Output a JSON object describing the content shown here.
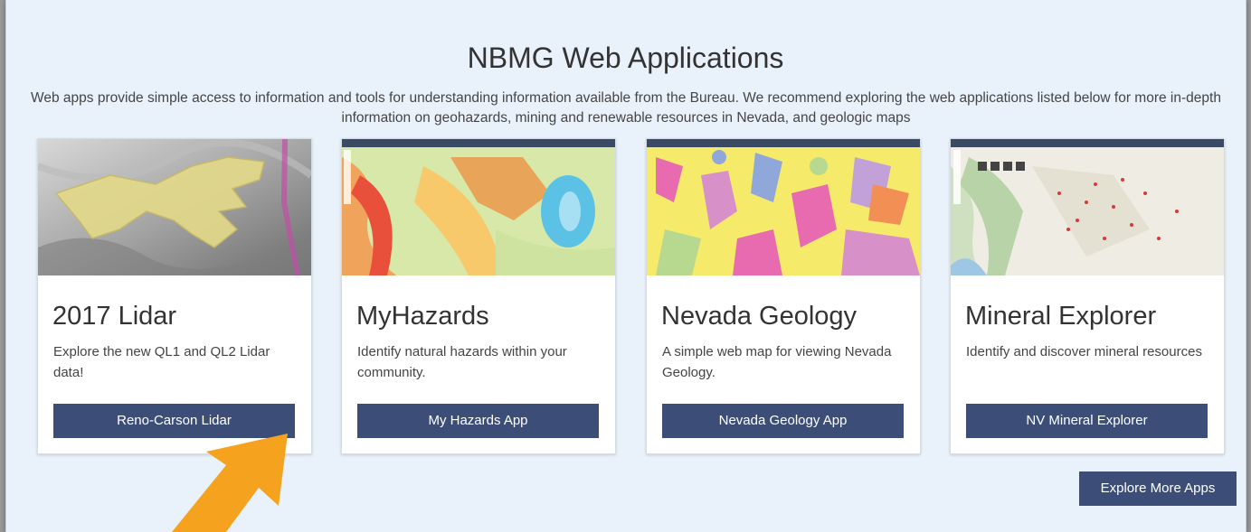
{
  "header": {
    "title": "NBMG Web Applications",
    "subtitle": "Web apps provide simple access to information and tools for understanding information available from the Bureau. We recommend exploring the web applications listed below for more in-depth information on geohazards, mining and renewable resources in Nevada, and geologic maps"
  },
  "cards": [
    {
      "title": "2017 Lidar",
      "description": "Explore the new QL1 and QL2 Lidar data!",
      "button": "Reno-Carson Lidar"
    },
    {
      "title": "MyHazards",
      "description": "Identify natural hazards within your community.",
      "button": "My Hazards App"
    },
    {
      "title": "Nevada Geology",
      "description": "A simple web map for viewing Nevada Geology.",
      "button": "Nevada Geology App"
    },
    {
      "title": "Mineral Explorer",
      "description": "Identify and discover mineral resources",
      "button": "NV Mineral Explorer"
    }
  ],
  "more_button": "Explore More Apps",
  "colors": {
    "button": "#3c4e78",
    "background": "#e9f1fa",
    "arrow": "#f5a21e"
  },
  "annotation_icon": "arrow-up-icon"
}
